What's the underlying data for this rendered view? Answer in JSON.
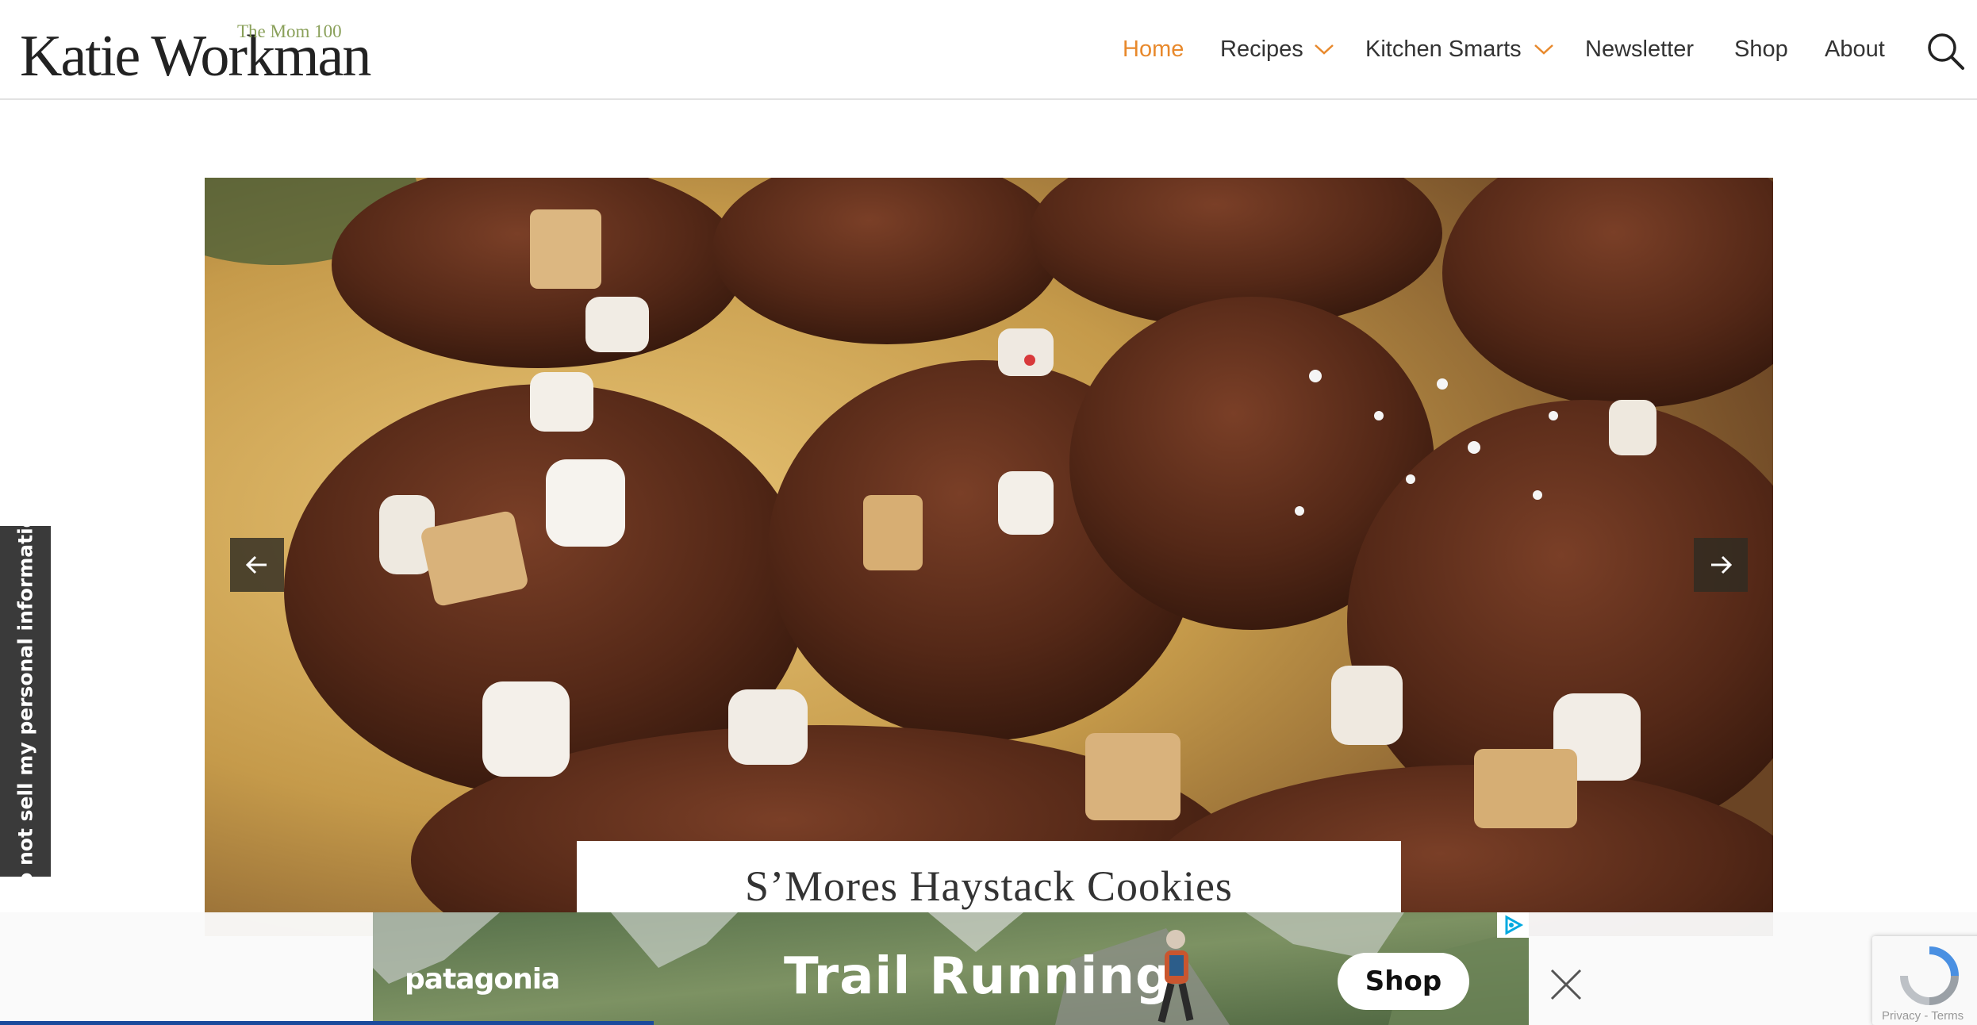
{
  "site": {
    "logo_text": "Katie Workman",
    "logo_subtitle": "The Mom 100"
  },
  "nav": {
    "items": [
      {
        "label": "Home",
        "active": true,
        "has_dropdown": false
      },
      {
        "label": "Recipes",
        "active": false,
        "has_dropdown": true
      },
      {
        "label": "Kitchen Smarts",
        "active": false,
        "has_dropdown": true
      },
      {
        "label": "Newsletter",
        "active": false,
        "has_dropdown": false
      },
      {
        "label": "Shop",
        "active": false,
        "has_dropdown": false
      },
      {
        "label": "About",
        "active": false,
        "has_dropdown": false
      }
    ],
    "active_color": "#e8892c",
    "search_icon": "search-icon"
  },
  "privacy_tab": {
    "label": "Do not sell my personal information"
  },
  "slider": {
    "caption": "S’Mores Haystack Cookies",
    "prev_icon": "arrow-left-icon",
    "next_icon": "arrow-right-icon"
  },
  "ad": {
    "brand": "patagonia",
    "headline": "Trail Running",
    "cta": "Shop",
    "close_icon": "close-icon",
    "adchoices_icon": "adchoices-icon"
  },
  "recaptcha": {
    "text": "Privacy - Terms"
  }
}
